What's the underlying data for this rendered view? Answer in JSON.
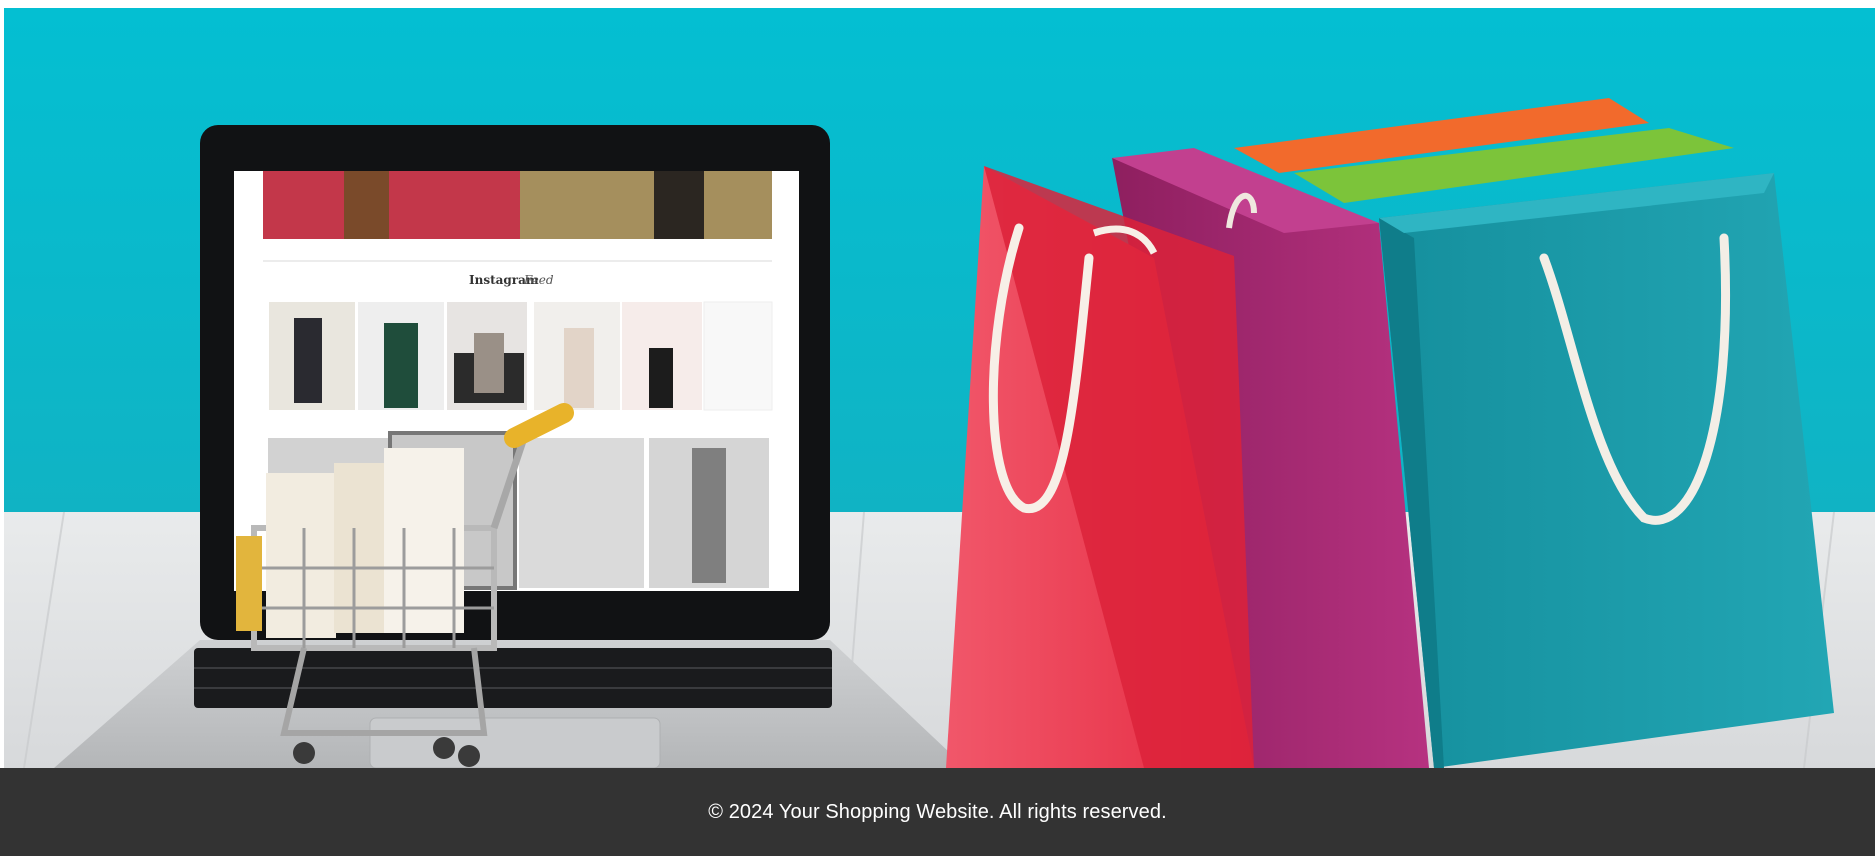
{
  "hero": {
    "image_alt": "Laptop with shopping cart and colorful shopping bags",
    "screen_heading_bold": "Instagram",
    "screen_heading_italic": "Feed",
    "colors": {
      "backdrop": "#03bccf",
      "floor": "#e4e6e8",
      "bag_red": "#ee3b4f",
      "bag_magenta": "#a8296e",
      "bag_teal": "#1a9cab",
      "bag_green": "#7cc43a",
      "bag_orange": "#f26a2c"
    }
  },
  "footer": {
    "copyright": "© 2024 Your Shopping Website. All rights reserved.",
    "background": "#333333"
  }
}
